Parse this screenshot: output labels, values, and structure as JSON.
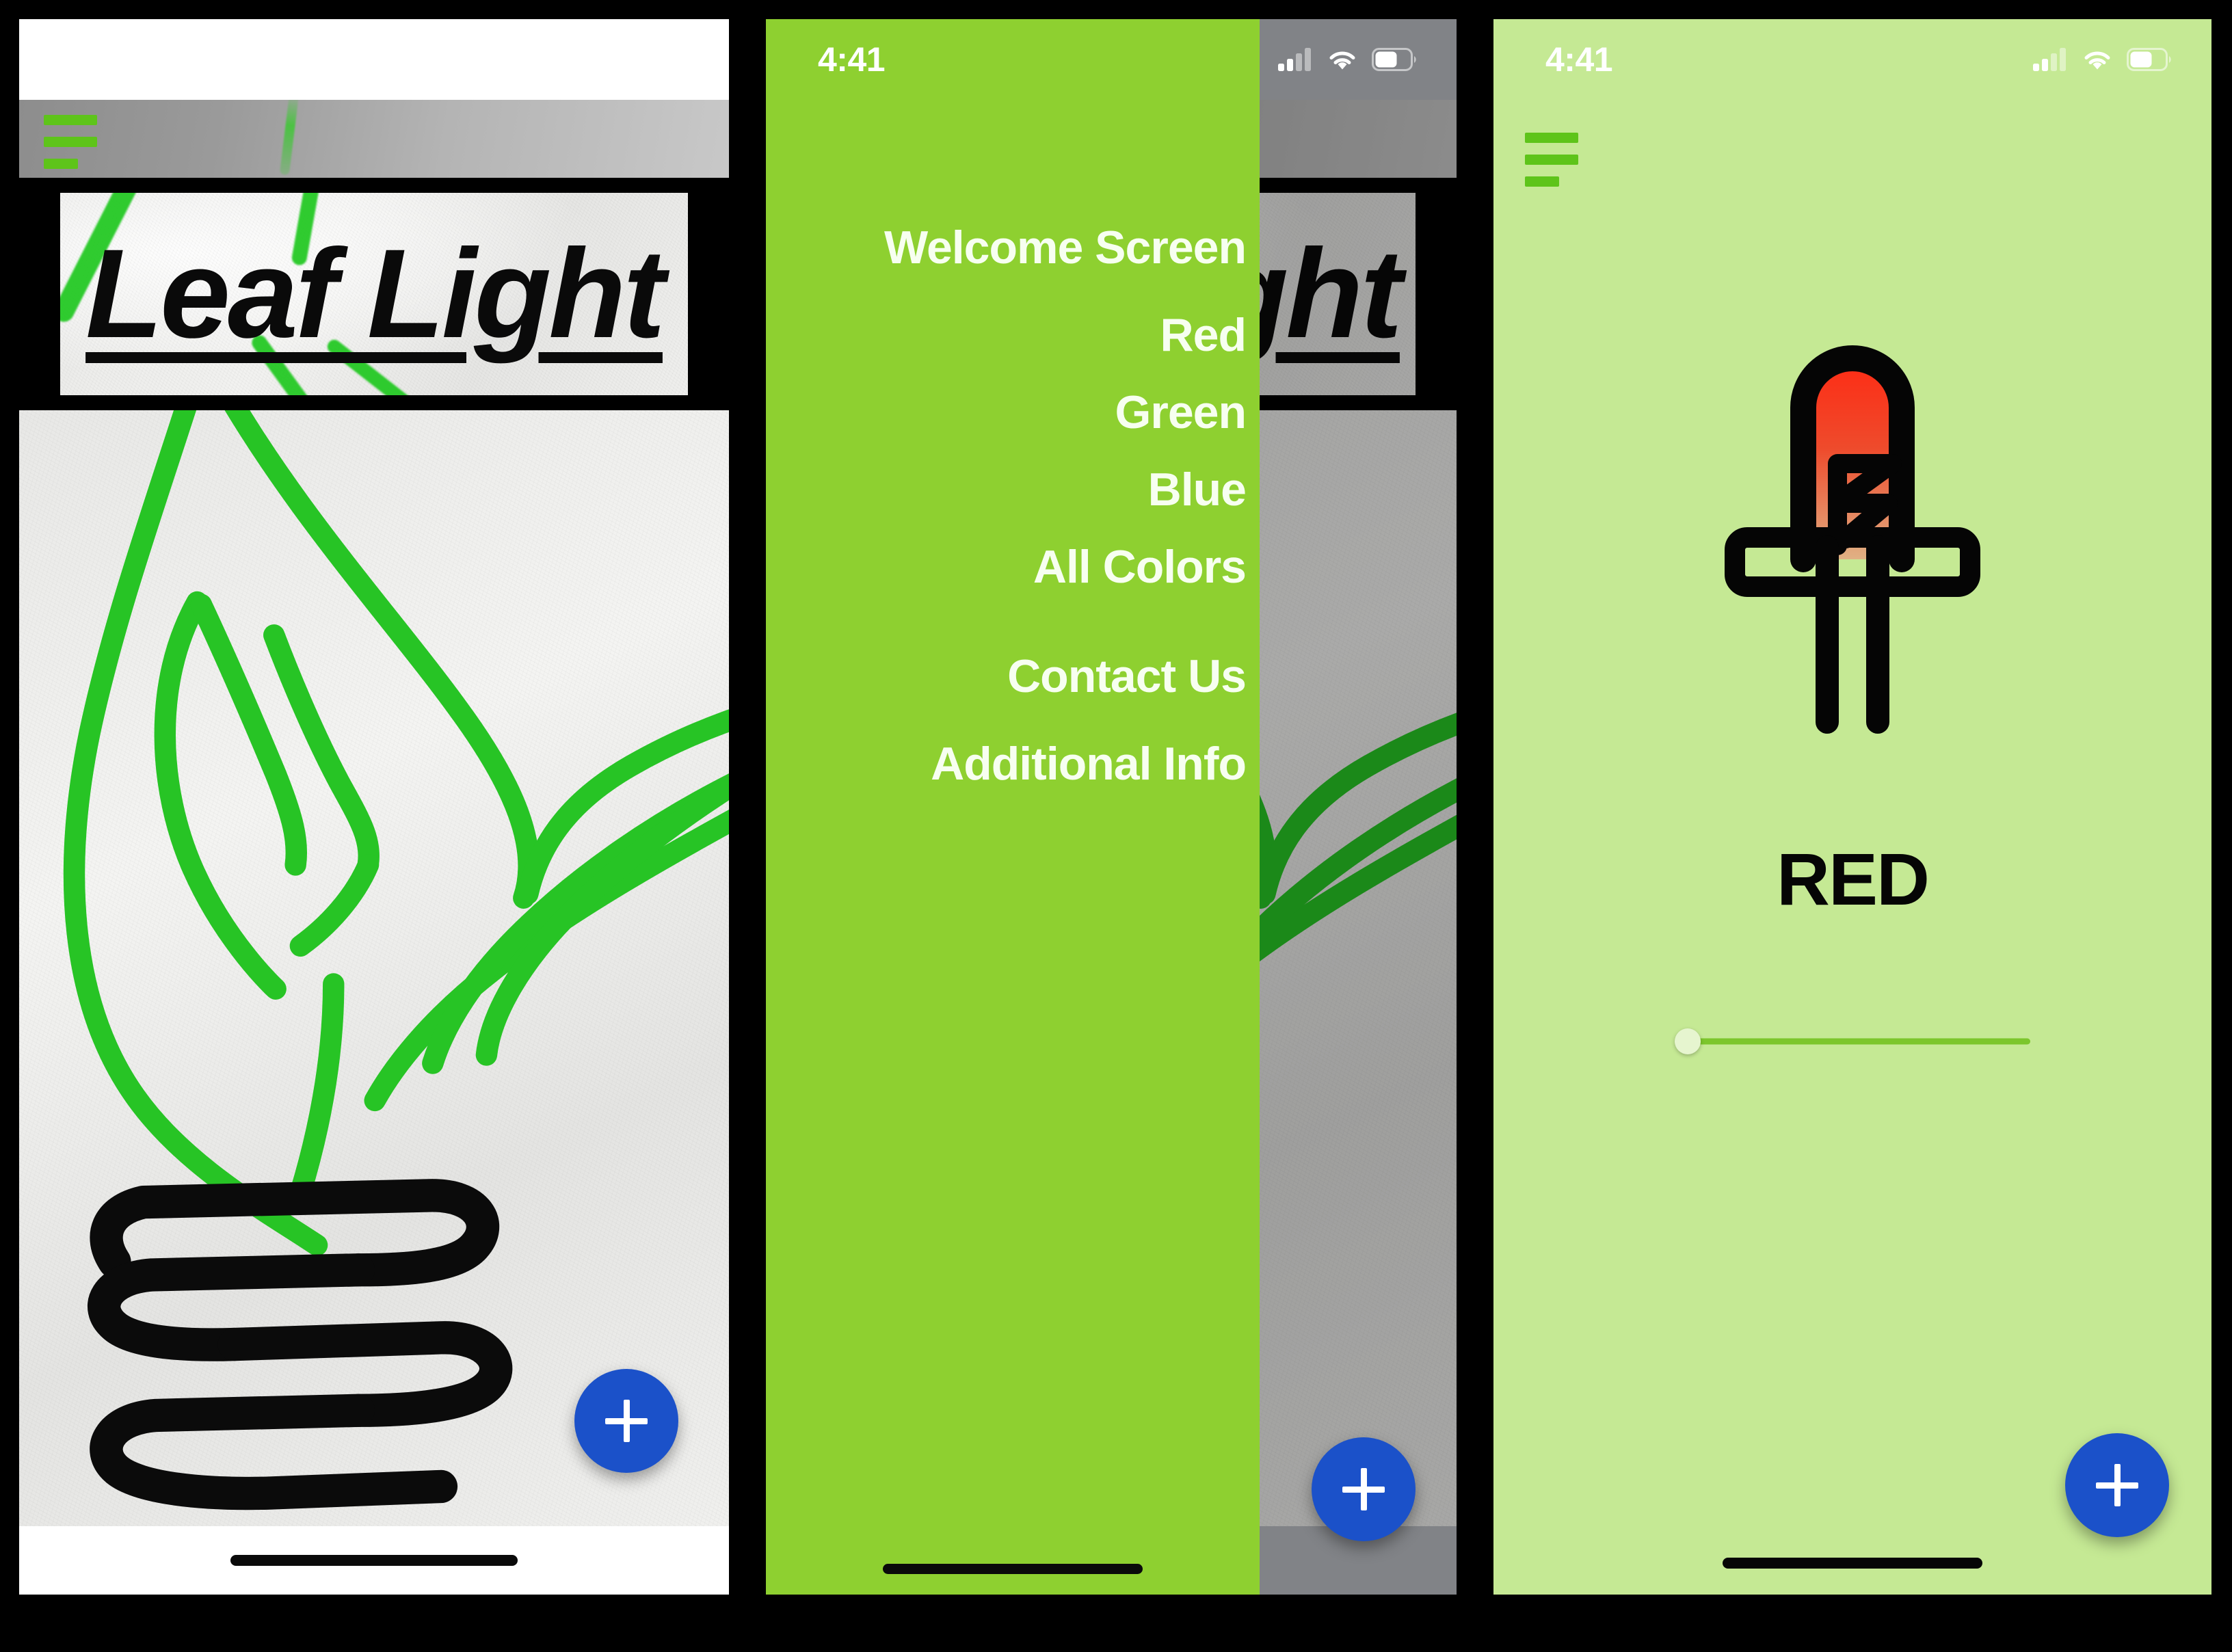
{
  "app": {
    "name": "Leaf Light",
    "accent_green": "#8ed030",
    "light_green_bg": "#c5e994",
    "fab_blue": "#1b51c9",
    "hamburger_green": "#5ec41a"
  },
  "status_bar": {
    "time": "4:41",
    "icons": [
      "cellular-signal-icon",
      "wifi-icon",
      "battery-icon"
    ]
  },
  "screens": [
    {
      "id": "welcome",
      "name": "Welcome Screen",
      "title": "Leaf Light",
      "menu_icon": "hamburger-menu-icon",
      "artwork": "hand-drawn-leaf-lightbulb",
      "fab_label": "+"
    },
    {
      "id": "drawer",
      "name": "Navigation Drawer",
      "title": "Leaf Light",
      "fab_label": "+"
    },
    {
      "id": "red",
      "name": "Red",
      "menu_icon": "hamburger-menu-icon",
      "led_icon": "led-bulb-icon",
      "color_label": "RED",
      "slider": {
        "value": 0,
        "min": 0,
        "max": 100
      },
      "fab_label": "+"
    }
  ],
  "drawer_menu": {
    "items": [
      {
        "label": "Welcome Screen"
      },
      {
        "label": "Red"
      },
      {
        "label": "Green"
      },
      {
        "label": "Blue"
      },
      {
        "label": "All Colors"
      },
      {
        "label": "Contact Us"
      },
      {
        "label": "Additional Info"
      }
    ]
  },
  "fab": {
    "label": "+",
    "name": "add-button"
  }
}
